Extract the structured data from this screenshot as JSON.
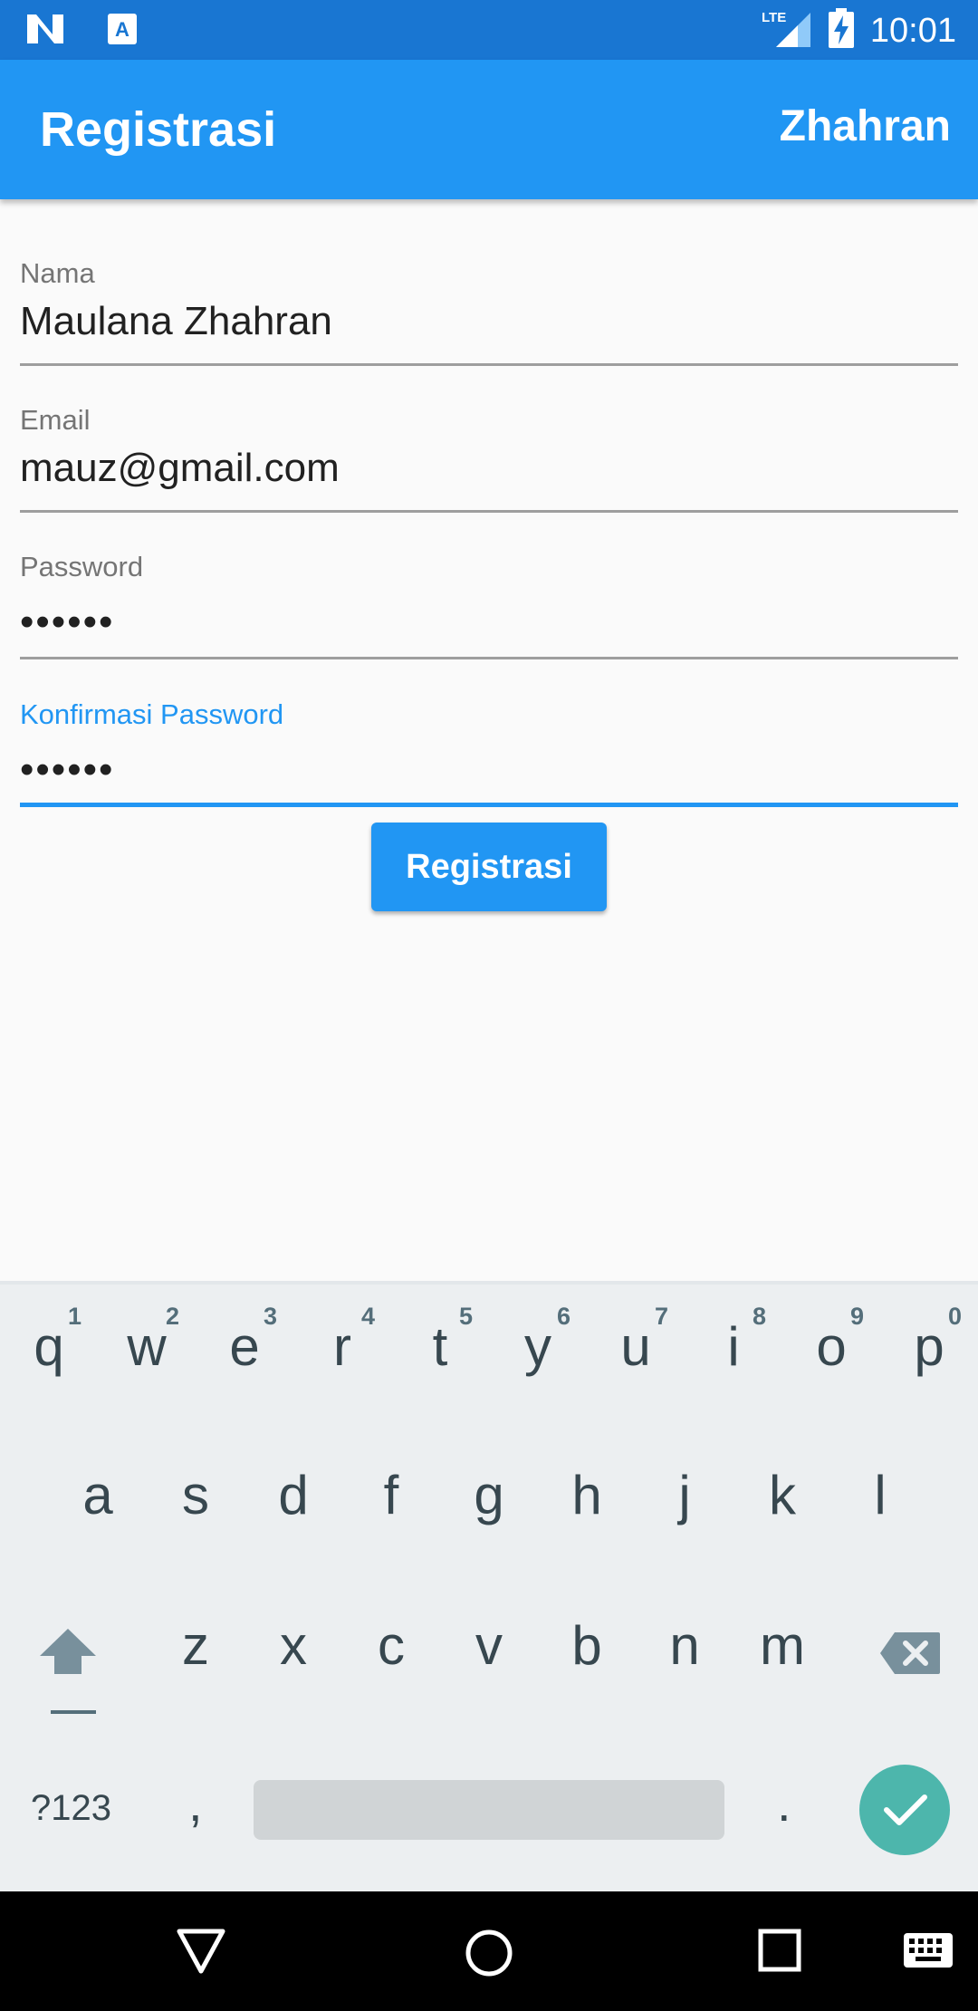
{
  "status_bar": {
    "time": "10:01",
    "network": "LTE"
  },
  "app_bar": {
    "title": "Registrasi",
    "action": "Zhahran"
  },
  "form": {
    "fields": [
      {
        "label": "Nama",
        "value": "Maulana Zhahran"
      },
      {
        "label": "Email",
        "value": "mauz@gmail.com"
      },
      {
        "label": "Password",
        "value": "••••••"
      },
      {
        "label": "Konfirmasi Password",
        "value": "••••••"
      }
    ],
    "submit_label": "Registrasi"
  },
  "keyboard": {
    "row1": [
      {
        "ch": "q",
        "num": "1"
      },
      {
        "ch": "w",
        "num": "2"
      },
      {
        "ch": "e",
        "num": "3"
      },
      {
        "ch": "r",
        "num": "4"
      },
      {
        "ch": "t",
        "num": "5"
      },
      {
        "ch": "y",
        "num": "6"
      },
      {
        "ch": "u",
        "num": "7"
      },
      {
        "ch": "i",
        "num": "8"
      },
      {
        "ch": "o",
        "num": "9"
      },
      {
        "ch": "p",
        "num": "0"
      }
    ],
    "row2": [
      "a",
      "s",
      "d",
      "f",
      "g",
      "h",
      "j",
      "k",
      "l"
    ],
    "row3": [
      "z",
      "x",
      "c",
      "v",
      "b",
      "n",
      "m"
    ],
    "symbols_label": "?123",
    "comma": ",",
    "period": "."
  },
  "colors": {
    "primary": "#2196f3",
    "status_bar": "#1976d2",
    "keyboard_bg": "#eceff1",
    "done_key": "#4db6ac"
  }
}
